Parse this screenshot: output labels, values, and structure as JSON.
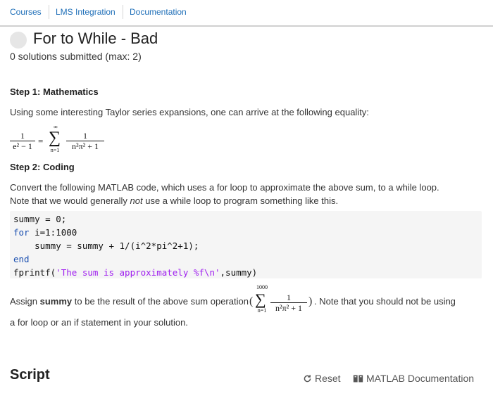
{
  "nav": {
    "tabs": [
      {
        "label": "Courses"
      },
      {
        "label": "LMS Integration"
      },
      {
        "label": "Documentation"
      }
    ]
  },
  "problem": {
    "title": "For to While - Bad",
    "submissions": "0 solutions submitted (max: 2)"
  },
  "step1": {
    "heading": "Step 1: Mathematics",
    "text": "Using some interesting Taylor series expansions, one can arrive at the following equality:"
  },
  "equation": {
    "lhs_num": "1",
    "lhs_den": "e² − 1",
    "equals": "=",
    "sigma": "∑",
    "upper": "∞",
    "lower": "n=1",
    "rhs_num": "1",
    "rhs_den": "n²π² + 1"
  },
  "step2": {
    "heading": "Step 2: Coding",
    "text_line1": "Convert the following MATLAB code, which uses a for loop to approximate the above sum, to a while loop.",
    "text_line2_a": "Note that we would generally ",
    "text_line2_em": "not",
    "text_line2_b": " use a while loop to program something like this."
  },
  "code": {
    "line1": "summy = 0;",
    "line2_kw": "for",
    "line2_rest": " i=1:1000",
    "line3": "    summy = summy + 1/(i^2*pi^2+1);",
    "line4_kw": "end",
    "line5_a": "fprintf(",
    "line5_str": "'The sum is approximately %f\\n'",
    "line5_b": ",summy)"
  },
  "assign": {
    "text_a": "Assign ",
    "text_bold": "summy",
    "text_b": " to be the result of the above sum operation",
    "paren_open": "(",
    "paren_close": ")",
    "sum_upper": "1000",
    "sum_lower": "n=1",
    "sum_num": "1",
    "sum_den": "n²π² + 1",
    "text_c": ". Note that you should not be using",
    "text_line2": "a for loop or an if statement in your solution."
  },
  "script": {
    "heading": "Script",
    "reset_label": "Reset",
    "doc_label": "MATLAB Documentation"
  },
  "colors": {
    "link": "#1f6fb8",
    "keyword": "#1a4fb0",
    "string": "#a020f0",
    "code_bg": "#f5f5f5"
  },
  "icons": {
    "reset": "refresh-icon",
    "doc": "book-icon"
  }
}
